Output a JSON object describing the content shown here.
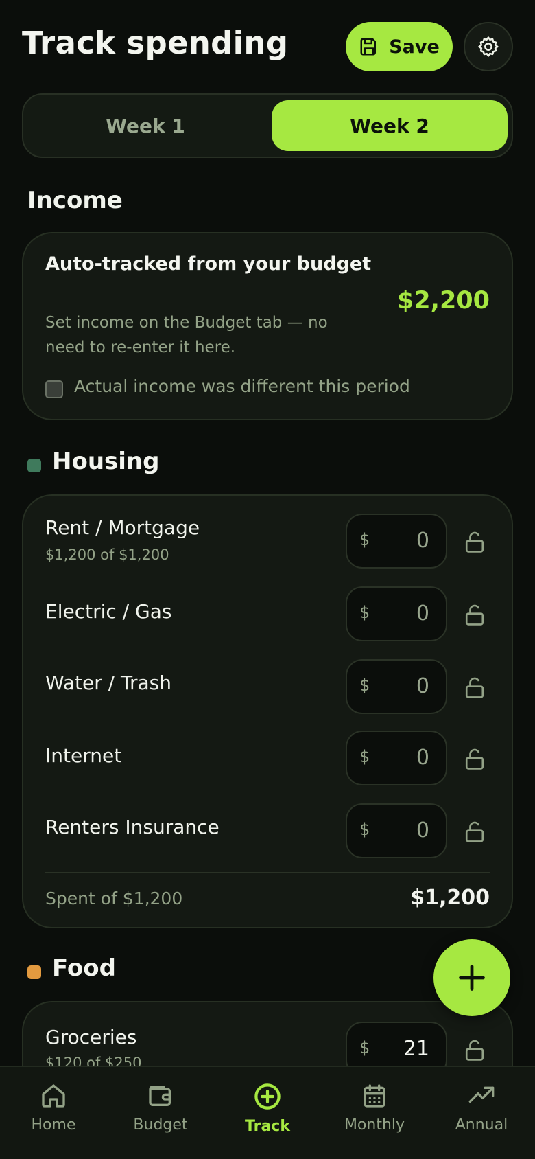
{
  "header": {
    "title": "Track spending",
    "save_label": "Save"
  },
  "tabs": [
    {
      "label": "Week 1",
      "active": false
    },
    {
      "label": "Week 2",
      "active": true
    }
  ],
  "income": {
    "section_title": "Income",
    "card_title": "Auto-tracked from your budget",
    "card_subtitle": "Set income on the Budget tab — no need to re-enter it here.",
    "amount": "$2,200",
    "checkbox_label": "Actual income was different this period",
    "checkbox_checked": false
  },
  "housing": {
    "section_title": "Housing",
    "dot_color": "#3f7a5c",
    "rows": [
      {
        "label": "Rent / Mortgage",
        "sub": "$1,200 of $1,200",
        "currency": "$",
        "value": "0"
      },
      {
        "label": "Electric / Gas",
        "currency": "$",
        "value": "0"
      },
      {
        "label": "Water / Trash",
        "currency": "$",
        "value": "0"
      },
      {
        "label": "Internet",
        "currency": "$",
        "value": "0"
      },
      {
        "label": "Renters Insurance",
        "currency": "$",
        "value": "0"
      }
    ],
    "spent_label": "Spent of $1,200",
    "spent_total": "$1,200"
  },
  "food": {
    "section_title": "Food",
    "dot_color": "#e39a3f",
    "rows": [
      {
        "label": "Groceries",
        "sub": "$120 of $250",
        "currency": "$",
        "value": "21"
      }
    ]
  },
  "nav": [
    {
      "label": "Home",
      "icon": "home-icon",
      "active": false
    },
    {
      "label": "Budget",
      "icon": "wallet-icon",
      "active": false
    },
    {
      "label": "Track",
      "icon": "plus-circle-icon",
      "active": true
    },
    {
      "label": "Monthly",
      "icon": "calendar-icon",
      "active": false
    },
    {
      "label": "Annual",
      "icon": "trending-up-icon",
      "active": false
    }
  ],
  "colors": {
    "accent": "#a6e841",
    "background": "#0b0e0b",
    "card": "#141913",
    "muted": "#93a287"
  }
}
